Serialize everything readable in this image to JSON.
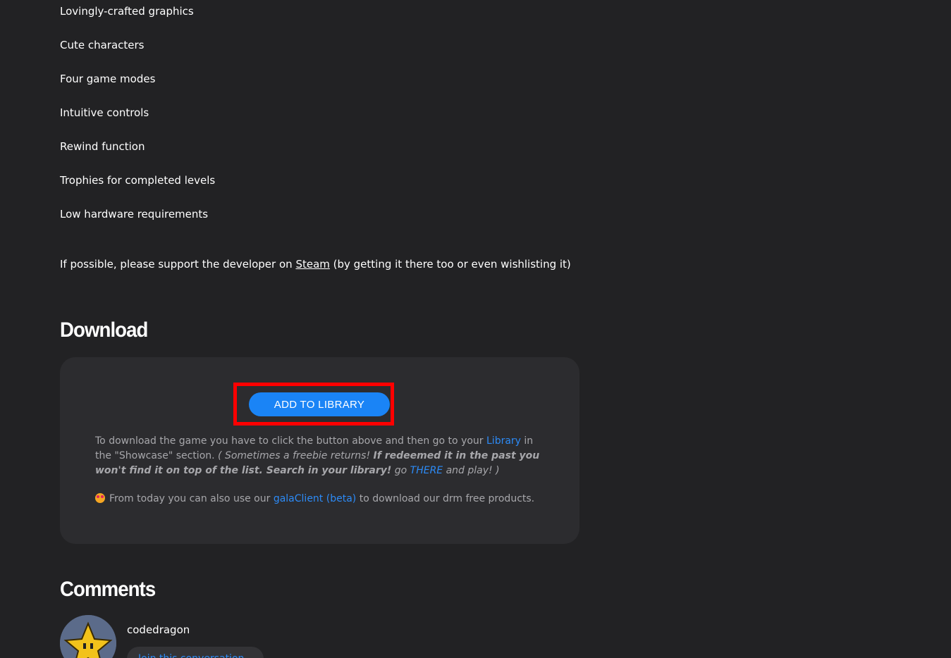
{
  "features": [
    "Lovingly-crafted graphics",
    "Cute characters",
    "Four game modes",
    "Intuitive controls",
    "Rewind function",
    "Trophies for completed levels",
    "Low hardware requirements"
  ],
  "support": {
    "prefix": "If possible, please support the developer on ",
    "link": "Steam",
    "suffix": " (by getting it there too or even wishlisting it)"
  },
  "download": {
    "heading": "Download",
    "button_label": "ADD TO LIBRARY",
    "text_1": "To download the game you have to click the button above and then go to your ",
    "library_link": "Library",
    "text_2": " in the \"Showcase\" section. ",
    "italic_1": "( Sometimes a freebie returns! ",
    "bold_italic": "If redeemed it in the past you won't find it on top of the list. Search in your library!",
    "italic_2": " go ",
    "there_link": "THERE",
    "italic_3": " and play! )",
    "gala_prefix": "From today you can also use our ",
    "gala_link": "galaClient (beta)",
    "gala_suffix": " to download our drm free products.",
    "highlight_color": "#ff0000",
    "button_color": "#1a84f6"
  },
  "comments": {
    "heading": "Comments",
    "username": "codedragon",
    "join_label": "Join this conversation"
  }
}
